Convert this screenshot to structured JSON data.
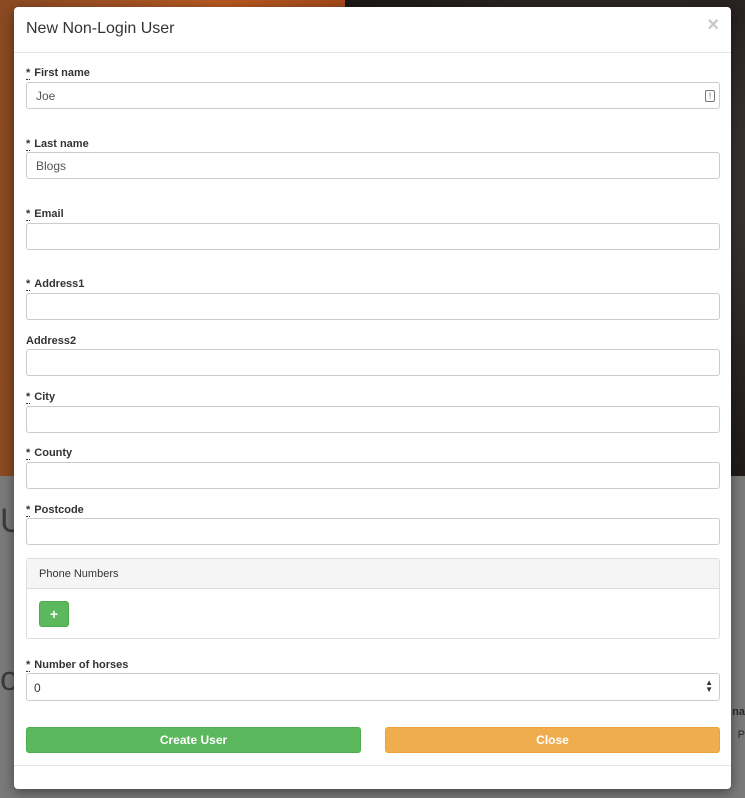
{
  "background": {
    "letter_top": "U",
    "letter_bottom": "og",
    "side_text_top": "na",
    "side_text_bottom": "P"
  },
  "modal": {
    "title": "New Non-Login User",
    "close_symbol": "×"
  },
  "fields": {
    "first_name": {
      "required_mark": "*",
      "label": "First name",
      "value": "Joe"
    },
    "last_name": {
      "required_mark": "*",
      "label": "Last name",
      "value": "Blogs"
    },
    "email": {
      "required_mark": "*",
      "label": "Email",
      "value": ""
    },
    "address1": {
      "required_mark": "*",
      "label": "Address1",
      "value": ""
    },
    "address2": {
      "label": "Address2",
      "value": ""
    },
    "city": {
      "required_mark": "*",
      "label": "City",
      "value": ""
    },
    "county": {
      "required_mark": "*",
      "label": "County",
      "value": ""
    },
    "postcode": {
      "required_mark": "*",
      "label": "Postcode",
      "value": ""
    }
  },
  "phone_panel": {
    "heading": "Phone Numbers",
    "add_label": "+"
  },
  "horses": {
    "required_mark": "*",
    "label": "Number of horses",
    "value": "0"
  },
  "actions": {
    "create_label": "Create User",
    "close_label": "Close"
  },
  "colors": {
    "success": "#5cb85c",
    "warning": "#f0ad4e"
  }
}
